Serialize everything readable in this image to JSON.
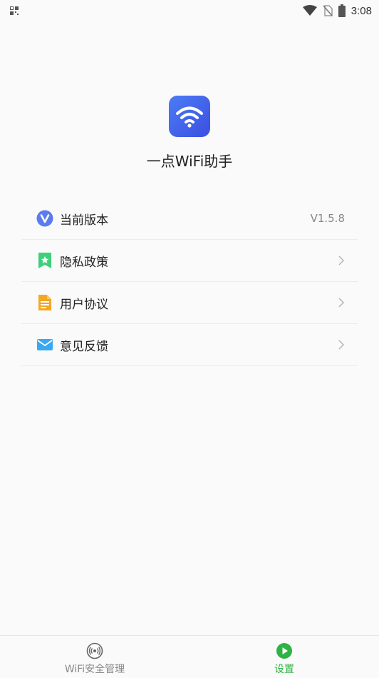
{
  "status_bar": {
    "time": "3:08",
    "icons": [
      "qr-scan-icon",
      "wifi-signal-icon",
      "no-sim-icon",
      "battery-icon"
    ]
  },
  "app": {
    "name": "一点WiFi助手",
    "logo_icon": "wifi-logo-icon"
  },
  "menu": {
    "items": [
      {
        "label": "当前版本",
        "value": "V1.5.8",
        "icon": "version-v-icon"
      },
      {
        "label": "隐私政策",
        "icon": "bookmark-star-icon"
      },
      {
        "label": "用户协议",
        "icon": "document-icon"
      },
      {
        "label": "意见反馈",
        "icon": "mail-icon"
      }
    ]
  },
  "bottom_nav": {
    "items": [
      {
        "label": "WiFi安全管理",
        "icon": "broadcast-icon",
        "active": false
      },
      {
        "label": "设置",
        "icon": "play-circle-icon",
        "active": true
      }
    ]
  },
  "colors": {
    "accent_green": "#2fb344",
    "logo_blue": "#4366ee",
    "version_icon": "#5b7cf0",
    "privacy_icon": "#3ecf7a",
    "agreement_icon": "#f5a623",
    "feedback_icon": "#3aa8f0"
  }
}
